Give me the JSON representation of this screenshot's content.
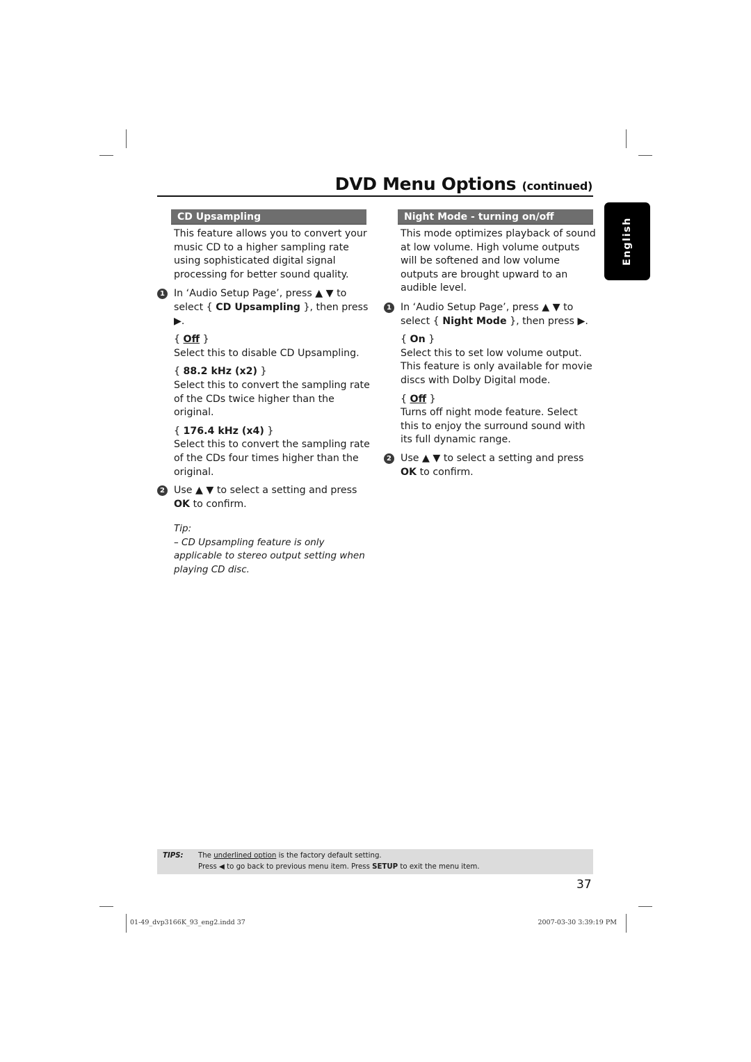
{
  "page": {
    "title": "DVD Menu Options",
    "title_suffix": "(continued)",
    "language_tab": "English",
    "page_number": "37"
  },
  "left_section": {
    "heading": "CD Upsampling",
    "intro": "This feature allows you to convert your music CD to a higher sampling rate using sophisticated digital signal processing for better sound quality.",
    "step1": {
      "number": "1",
      "text_a": "In ‘Audio Setup Page’, press ▲ ▼ to select { ",
      "bold": "CD Upsampling",
      "text_b": " }, then press ▶."
    },
    "options": [
      {
        "label": "Off",
        "default": true,
        "description": "Select this to disable CD Upsampling."
      },
      {
        "label": "88.2 kHz (x2)",
        "default": false,
        "description": "Select this to convert the sampling rate of the CDs twice higher than the original."
      },
      {
        "label": "176.4 kHz (x4)",
        "default": false,
        "description": "Select this to convert the sampling rate of the CDs four times higher than the original."
      }
    ],
    "step2": {
      "number": "2",
      "text_a": "Use ▲ ▼ to select a setting and press ",
      "bold": "OK",
      "text_b": " to confirm."
    },
    "tip_label": "Tip:",
    "tip_text": "– CD Upsampling feature is only applicable to stereo output setting when playing CD disc."
  },
  "right_section": {
    "heading": "Night Mode - turning on/off",
    "intro": "This mode optimizes playback of sound at low volume. High volume outputs will be softened and low volume outputs are brought upward to an audible level.",
    "step1": {
      "number": "1",
      "text_a": "In ‘Audio Setup Page’, press ▲ ▼ to select { ",
      "bold": "Night Mode",
      "text_b": " }, then press ▶."
    },
    "options": [
      {
        "label": "On",
        "default": false,
        "description": "Select this to set low volume output. This feature is only available for movie discs with Dolby Digital mode."
      },
      {
        "label": "Off",
        "default": true,
        "description": "Turns off night mode feature. Select this to enjoy the surround sound with its full dynamic range."
      }
    ],
    "step2": {
      "number": "2",
      "text_a": "Use ▲ ▼ to select a setting and press ",
      "bold": "OK",
      "text_b": " to confirm."
    }
  },
  "tips_bar": {
    "label": "TIPS:",
    "line1_a": "The ",
    "line1_underlined": "underlined option",
    "line1_b": " is the factory default setting.",
    "line2_a": "Press ◀ to go back to previous menu item. Press ",
    "line2_bold": "SETUP",
    "line2_b": " to exit the menu item."
  },
  "footer": {
    "file": "01-49_dvp3166K_93_eng2.indd   37",
    "timestamp": "2007-03-30   3:39:19 PM"
  },
  "colors": {
    "section_header_bg": "#6e6e6e",
    "language_tab_bg": "#000000",
    "tips_bar_bg": "#dcdcdc"
  }
}
